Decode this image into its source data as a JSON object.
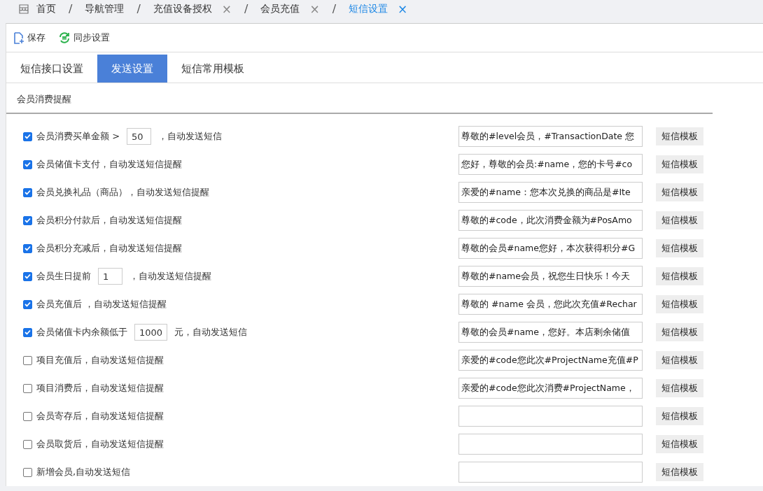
{
  "breadcrumbs": [
    {
      "label": "首页",
      "closable": false,
      "selected": false,
      "kind": "home"
    },
    {
      "label": "导航管理",
      "closable": false,
      "selected": false
    },
    {
      "label": "充值设备授权",
      "closable": true,
      "selected": false
    },
    {
      "label": "会员充值",
      "closable": true,
      "selected": false
    },
    {
      "label": "短信设置",
      "closable": true,
      "selected": true
    }
  ],
  "separator": "/",
  "close_glyph": "×",
  "toolbar": [
    {
      "label": "保存",
      "kind": "save"
    },
    {
      "label": "同步设置",
      "kind": "sync"
    }
  ],
  "tabs": [
    {
      "label": "短信接口设置",
      "selected": false
    },
    {
      "label": "发送设置",
      "selected": true
    },
    {
      "label": "短信常用模板",
      "selected": false
    }
  ],
  "section_title": "会员消费提醒",
  "rules": [
    {
      "checked": true,
      "label": "会员消费买单金额 >",
      "value": "50",
      "suffix": "，自动发送短信",
      "message": "尊敬的#level会员，#TransactionDate 您",
      "button": "短信模板"
    },
    {
      "checked": true,
      "label": "会员储值卡支付，自动发送短信提醒",
      "message": "您好，尊敬的会员:#name，您的卡号#co",
      "button": "短信模板"
    },
    {
      "checked": true,
      "label": "会员兑换礼品（商品），自动发送短信提醒",
      "message": "亲爱的#name：您本次兑换的商品是#Ite",
      "button": "短信模板"
    },
    {
      "checked": true,
      "label": "会员积分付款后，自动发送短信提醒",
      "message": "尊敬的#code，此次消费金额为#PosAmo",
      "button": "短信模板"
    },
    {
      "checked": true,
      "label": "会员积分充减后，自动发送短信提醒",
      "message": "尊敬的会员#name您好，本次获得积分#G",
      "button": "短信模板"
    },
    {
      "checked": true,
      "label": "会员生日提前",
      "value": "1",
      "suffix": "，自动发送短信提醒",
      "message": "尊敬的#name会员，祝您生日快乐！今天",
      "button": "短信模板"
    },
    {
      "checked": true,
      "label": "会员充值后 ，自动发送短信提醒",
      "message": "尊敬的 #name 会员，您此次充值#Rechar",
      "button": "短信模板"
    },
    {
      "checked": true,
      "label": "会员储值卡内余额低于",
      "value": "1000",
      "suffix": "元，自动发送短信",
      "message": "尊敬的会员#name，您好。本店剩余储值",
      "button": "短信模板"
    },
    {
      "checked": false,
      "label": "项目充值后，自动发送短信提醒",
      "message": "亲爱的#code您此次#ProjectName充值#P",
      "button": "短信模板"
    },
    {
      "checked": false,
      "label": "项目消费后，自动发送短信提醒",
      "message": "亲爱的#code您此次消费#ProjectName，",
      "button": "短信模板"
    },
    {
      "checked": false,
      "label": "会员寄存后，自动发送短信提醒",
      "button": "短信模板"
    },
    {
      "checked": false,
      "label": "会员取货后，自动发送短信提醒",
      "button": "短信模板"
    },
    {
      "checked": false,
      "label": "新增会员,自动发送短信",
      "button": "短信模板"
    }
  ]
}
